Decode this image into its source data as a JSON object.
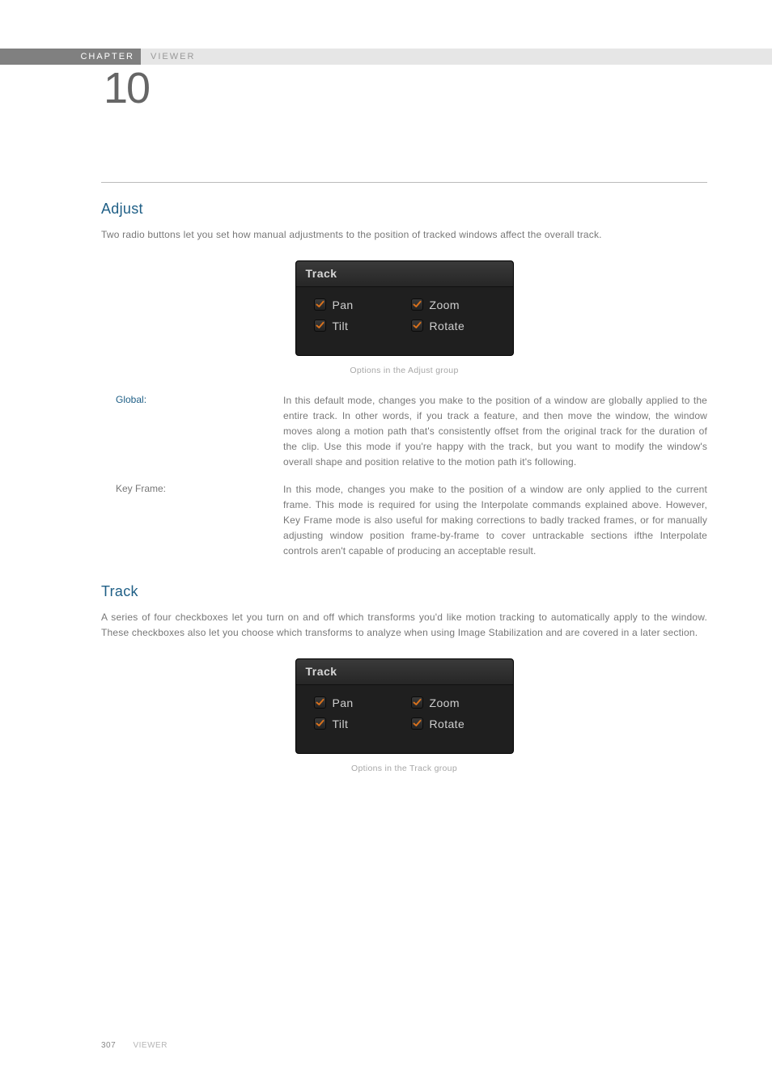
{
  "banner": {
    "chapter_label": "CHAPTER",
    "section_label": "VIEWER",
    "chapter_number": "10"
  },
  "adjust": {
    "heading": "Adjust",
    "intro": "Two radio buttons let you set how manual adjustments to the position of tracked windows affect the overall track."
  },
  "panel1": {
    "title": "Track",
    "pan": "Pan",
    "zoom": "Zoom",
    "tilt": "Tilt",
    "rotate": "Rotate"
  },
  "caption1": "Options in the Adjust group",
  "defs": {
    "global_label": "Global:",
    "global_body": "In this default mode, changes you make to the position of a window are globally applied to the entire track. In other words, if you track a feature, and then move the window, the window moves along a motion path that's consistently offset from the original track for the duration of the clip. Use this mode if you're happy with the track, but you want to modify the window's overall shape and position relative to the motion path it's following.",
    "keyframe_label": "Key Frame:",
    "keyframe_body": "In this mode, changes you make to the position of a window are only applied to the current frame. This mode is required for using the Interpolate commands explained above. However, Key Frame mode is also useful for making corrections to badly tracked frames, or for manually adjusting window position frame-by-frame to cover untrackable sections ifthe Interpolate controls aren't capable of producing an acceptable result."
  },
  "track": {
    "heading": "Track",
    "intro": "A series of four checkboxes let you turn on and off which transforms you'd like motion tracking to automatically apply to the window. These checkboxes also let you choose which transforms to analyze when using Image Stabilization and are covered in a later section."
  },
  "panel2": {
    "title": "Track",
    "pan": "Pan",
    "zoom": "Zoom",
    "tilt": "Tilt",
    "rotate": "Rotate"
  },
  "caption2": "Options in the Track group",
  "footer": {
    "page": "307",
    "section": "VIEWER"
  }
}
